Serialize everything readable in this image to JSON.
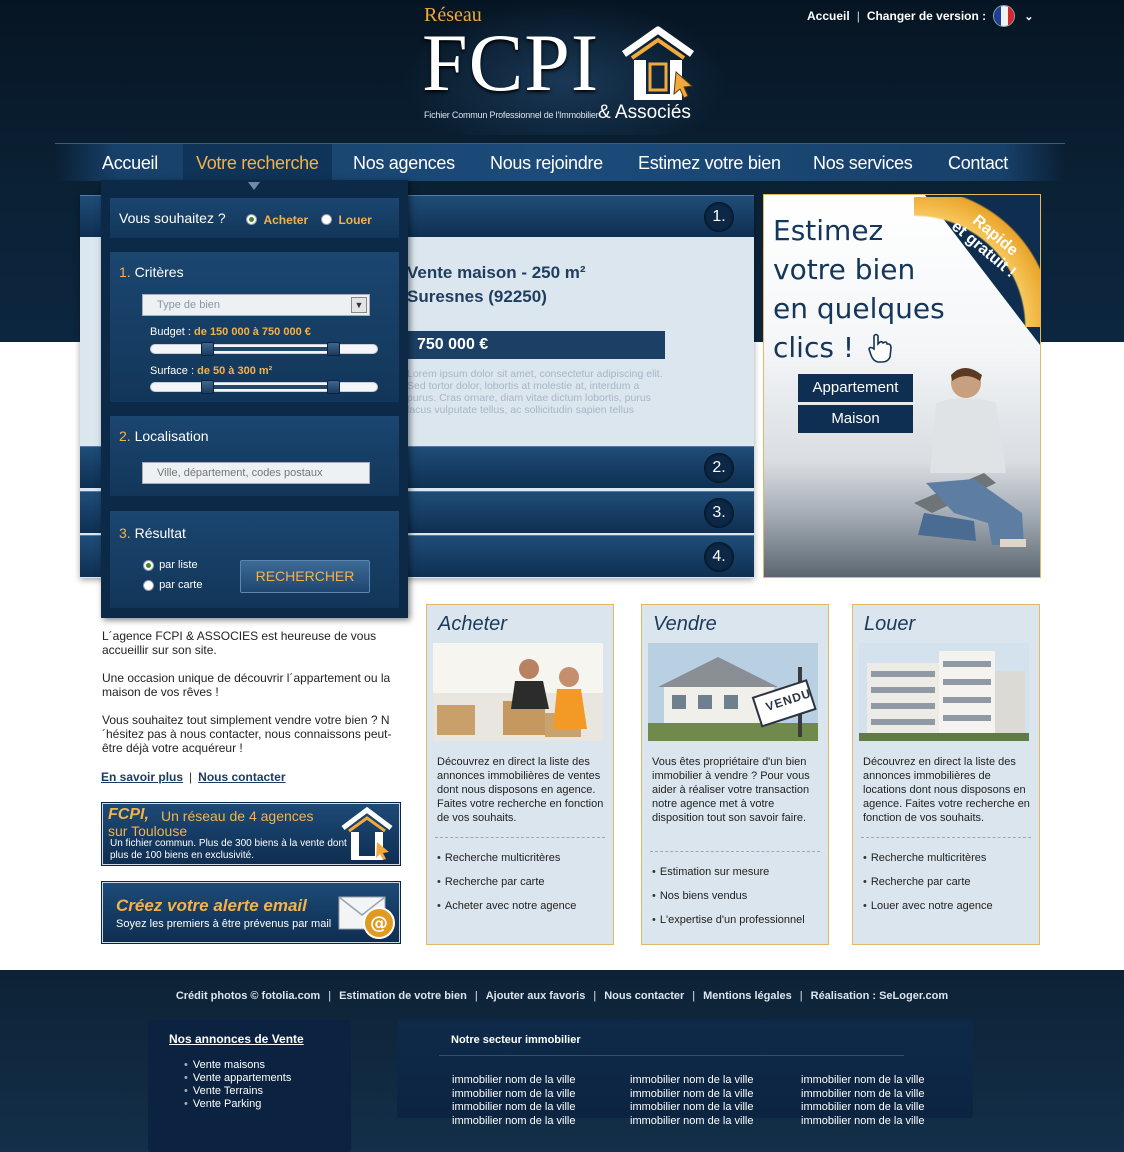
{
  "header": {
    "logo": {
      "reseau": "Réseau",
      "name": "FCPI",
      "tagline": "Fichier Commun Professionnel de l'Immobilier",
      "associes": "& Associés"
    },
    "top_links": {
      "home": "Accueil",
      "separator": "|",
      "change_version": "Changer de version :"
    }
  },
  "nav": {
    "items": [
      "Accueil",
      "Votre recherche",
      "Nos agences",
      "Nous rejoindre",
      "Estimez votre bien",
      "Nos services",
      "Contact"
    ],
    "active": "Votre recherche"
  },
  "search": {
    "question": "Vous souhaitez ?",
    "options": [
      "Acheter",
      "Louer"
    ],
    "selected": "Acheter",
    "criteria": {
      "number": "1.",
      "heading": "Critères",
      "type_placeholder": "Type de bien",
      "budget_label": "Budget :",
      "budget_value": "de 150 000 à 750 000 €",
      "surface_label": "Surface :",
      "surface_value": "de 50 à 300 m²"
    },
    "location": {
      "number": "2.",
      "heading": "Localisation",
      "placeholder": "Ville, département, codes postaux"
    },
    "result": {
      "number": "3.",
      "heading": "Résultat",
      "options": [
        "par liste",
        "par carte"
      ],
      "selected": "par liste",
      "button": "RECHERCHER"
    }
  },
  "slider": {
    "numbers": [
      "1.",
      "2.",
      "3.",
      "4."
    ],
    "listing": {
      "title_line1": "Vente maison - 250 m²",
      "title_line2": "Suresnes (92250)",
      "price": "750 000 €",
      "description": "Lorem ipsum dolor sit amet, consectetur adipiscing elit. Sed tortor dolor, lobortis at molestie at, interdum a purus. Cras ornare, diam vitae dictum lobortis, purus lacus vulputate tellus, ac sollicitudin sapien tellus"
    }
  },
  "promo": {
    "corner_line1": "Rapide",
    "corner_line2": "et gratuit !",
    "headline": [
      "Estimez",
      "votre bien",
      "en quelques",
      "clics !"
    ],
    "buttons": [
      "Appartement",
      "Maison"
    ]
  },
  "intro": {
    "paragraphs": [
      "L´agence FCPI & ASSOCIES est heureuse de vous accueillir sur son site.",
      "Une occasion unique de découvrir l´appartement ou la maison de vos rêves !",
      "Vous souhaitez tout simplement vendre votre bien ? N´hésitez pas à nous contacter, nous connaissons peut-être déjà votre acquéreur !"
    ],
    "links": [
      "En savoir plus",
      "Nous contacter"
    ],
    "separator": "|"
  },
  "banners": {
    "network": {
      "brand": "FCPI,",
      "line1": "Un réseau de 4 agences",
      "line2": "sur Toulouse",
      "line3": "Un fichier commun. Plus de 300 biens à la vente dont plus de 100 biens en exclusivité."
    },
    "alert": {
      "title": "Créez votre alerte email",
      "subtitle": "Soyez les premiers à être prévenus par mail"
    }
  },
  "cards": [
    {
      "title": "Acheter",
      "description": "Découvrez en direct la liste des annonces immobilières de ventes dont nous disposons en agence. Faites votre recherche en fonction de vos souhaits.",
      "items": [
        "Recherche multicritères",
        "Recherche par carte",
        "Acheter avec notre agence"
      ]
    },
    {
      "title": "Vendre",
      "description": "Vous êtes propriétaire d'un bien immobilier à vendre ? Pour vous aider à réaliser votre transaction notre agence met à votre disposition tout son savoir faire.",
      "items": [
        "Estimation sur mesure",
        "Nos biens vendus",
        "L'expertise d'un professionnel"
      ],
      "sign_text": "VENDU"
    },
    {
      "title": "Louer",
      "description": "Découvrez en direct la liste des annonces immobilières de locations dont nous disposons en agence. Faites votre recherche en fonction de vos souhaits.",
      "items": [
        "Recherche multicritères",
        "Recherche par carte",
        "Louer avec notre agence"
      ]
    }
  ],
  "footer": {
    "links": [
      "Crédit photos © fotolia.com",
      "Estimation de votre bien",
      "Ajouter aux favoris",
      "Nous contacter",
      "Mentions légales",
      "Réalisation : SeLoger.com"
    ],
    "separator": "|",
    "ventes": {
      "heading": "Nos annonces de Vente",
      "items": [
        "Vente maisons",
        "Vente appartements",
        "Vente Terrains",
        "Vente Parking"
      ]
    },
    "secteur": {
      "heading": "Notre secteur immobilier",
      "columns": [
        [
          "immobilier nom de la ville",
          "immobilier nom de la ville",
          "immobilier nom de la ville",
          "immobilier nom de la ville"
        ],
        [
          "immobilier nom de la ville",
          "immobilier nom de la ville",
          "immobilier nom de la ville",
          "immobilier nom de la ville"
        ],
        [
          "immobilier nom de la ville",
          "immobilier nom de la ville",
          "immobilier nom de la ville",
          "immobilier nom de la ville"
        ]
      ]
    }
  },
  "colors": {
    "navy": "#0c2947",
    "accent": "#f4b24a",
    "card_bg": "#dbe5ee",
    "card_border": "#e2b868"
  },
  "icons": [
    "house-logo-icon",
    "france-flag-icon",
    "chevron-down-icon",
    "hand-cursor-icon",
    "email-envelope-icon",
    "select-arrow-icon"
  ]
}
